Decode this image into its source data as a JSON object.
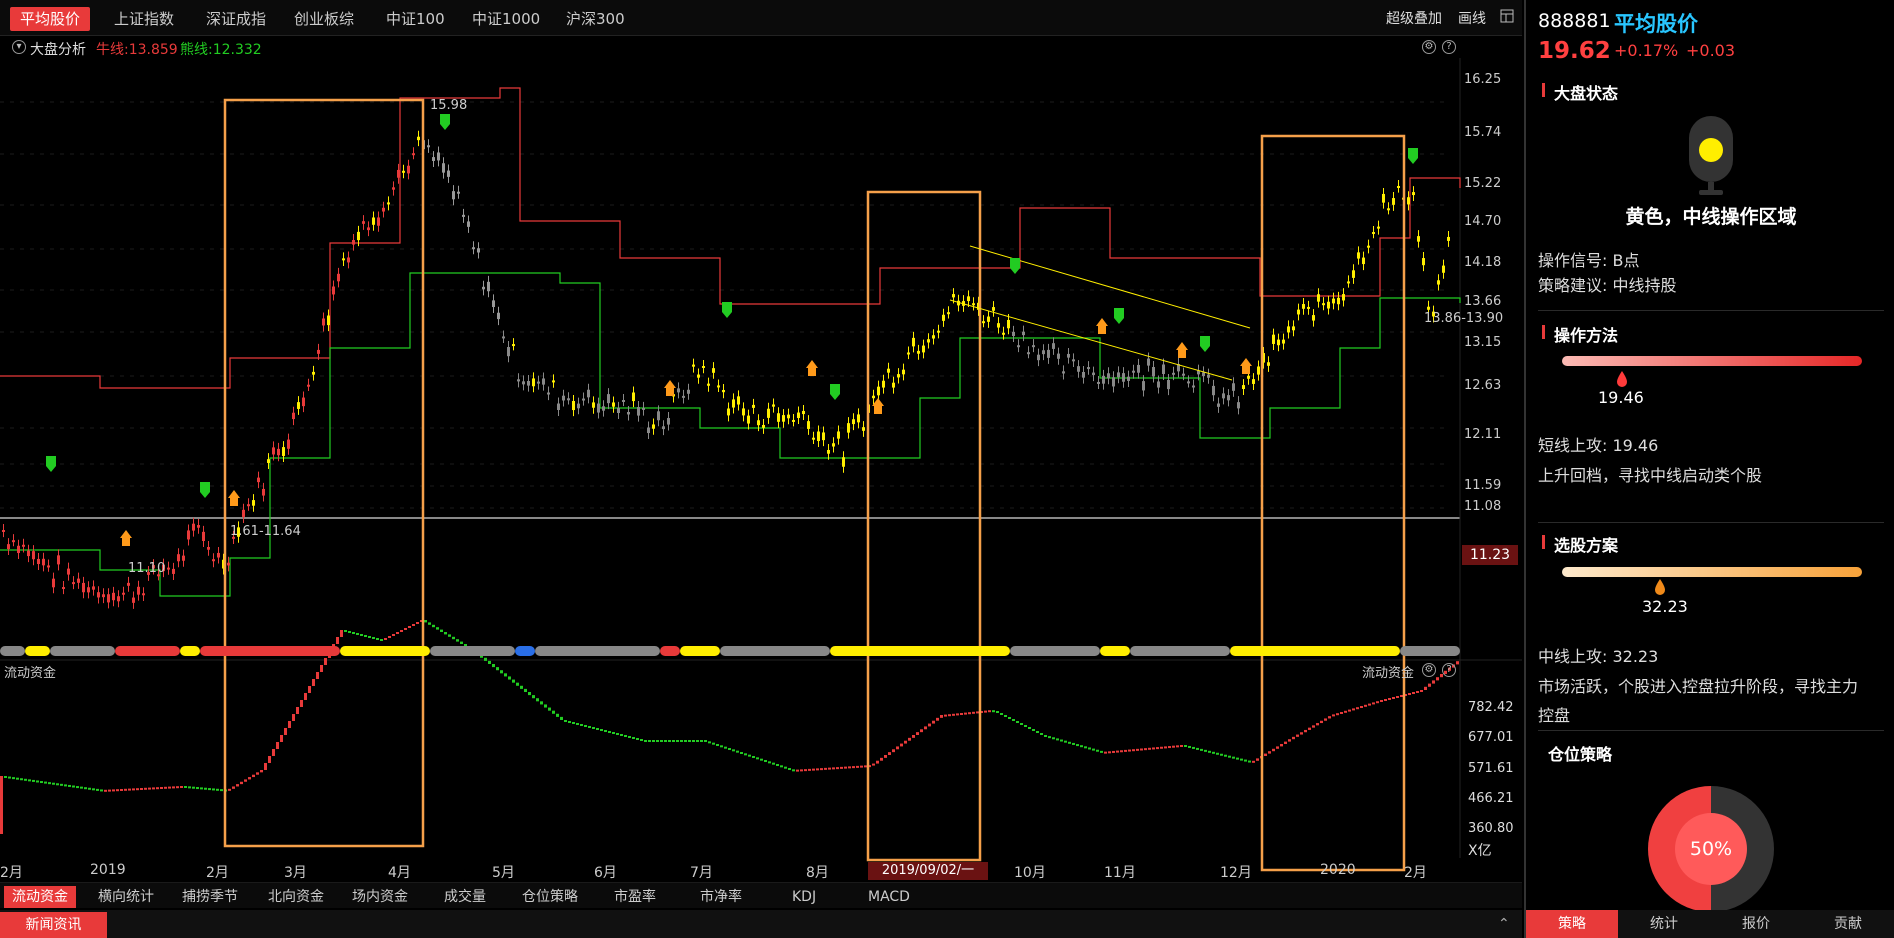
{
  "top_tabs": [
    "平均股价",
    "上证指数",
    "深证成指",
    "创业板综",
    "中证100",
    "中证1000",
    "沪深300"
  ],
  "top_right": {
    "overlay": "超级叠加",
    "draw": "画线",
    "grid_icon": "grid-icon"
  },
  "indicator_bar": {
    "name": "大盘分析",
    "bull_label": "牛线:13.859",
    "bear_label": "熊线:12.332"
  },
  "main_chart": {
    "price_axis": [
      "16.25",
      "15.74",
      "15.22",
      "14.70",
      "14.18",
      "13.66",
      "13.15",
      "12.63",
      "12.11",
      "11.59",
      "11.08"
    ],
    "current_price_tag": "11.23",
    "annotations": {
      "high": "15.98",
      "low_left": "11.10",
      "range_mid": "1.61-11.64",
      "right": "13.86-13.90"
    }
  },
  "flow_chart": {
    "title": "流动资金",
    "title_right": "流动资金",
    "axis": [
      "782.42",
      "677.01",
      "571.61",
      "466.21",
      "360.80"
    ],
    "unit": "X亿"
  },
  "date_axis": [
    "2月",
    "2019",
    "2月",
    "3月",
    "4月",
    "5月",
    "6月",
    "7月",
    "8月",
    "2019/09/02/一",
    "10月",
    "11月",
    "12月",
    "2020",
    "2月"
  ],
  "bottom_tabs": [
    "流动资金",
    "横向统计",
    "捕捞季节",
    "北向资金",
    "场内资金",
    "成交量",
    "仓位策略",
    "市盈率",
    "市净率",
    "KDJ",
    "MACD"
  ],
  "news_button": "新闻资讯",
  "sidebar": {
    "code": "888881",
    "name": "平均股价",
    "price": "19.62",
    "change_pct": "+0.17%",
    "change": "+0.03",
    "market_state_title": "大盘状态",
    "light_text": "黄色，中线操作区域",
    "signal": "操作信号: B点",
    "advice": "策略建议: 中线持股",
    "method_title": "操作方法",
    "method_value": "19.46",
    "short_attack": "短线上攻: 19.46",
    "short_desc": "上升回档，寻找中线启动类个股",
    "select_title": "选股方案",
    "select_value": "32.23",
    "mid_attack": "中线上攻: 32.23",
    "mid_desc_1": "市场活跃，个股进入控盘拉升阶段，寻找主力",
    "mid_desc_2": "控盘",
    "position_title": "仓位策略",
    "position_value": "50%",
    "tabs": [
      "策略",
      "统计",
      "报价",
      "贡献"
    ]
  },
  "colors": {
    "accent": "#e83a3a",
    "bull": "#e83a3a",
    "bear": "#22cc22",
    "highlight_box": "#f5a04a",
    "yellow": "#ffee00"
  }
}
